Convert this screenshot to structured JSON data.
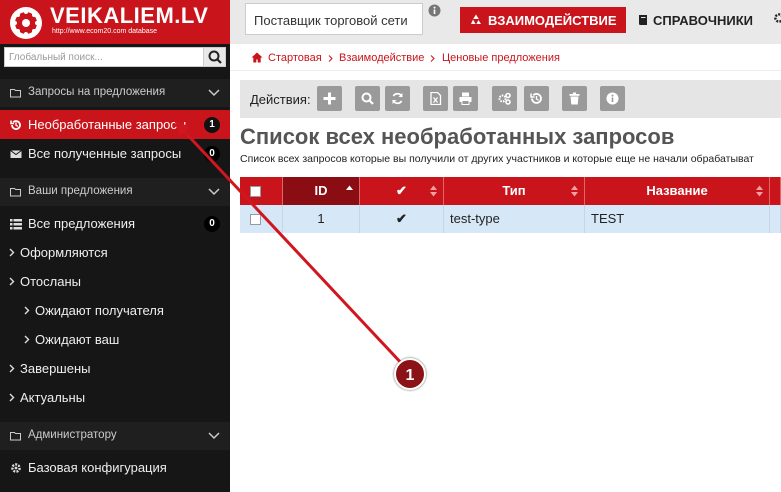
{
  "brand": {
    "name": "VEIKALIEM.LV",
    "url_text": "http://www.ecom20.com database"
  },
  "search": {
    "placeholder": "Глобальный поиск..."
  },
  "sidebar": {
    "groups": [
      {
        "label": "Запросы на предложения"
      },
      {
        "label": "Ваши предложения"
      },
      {
        "label": "Администратору"
      }
    ],
    "items": [
      {
        "label": "Необработанные запросы",
        "badge": "1"
      },
      {
        "label": "Все полученные запросы",
        "badge": "0"
      },
      {
        "label": "Все предложения",
        "badge": "0"
      },
      {
        "label": "Оформляются"
      },
      {
        "label": "Отосланы"
      },
      {
        "label": "Ожидают получателя"
      },
      {
        "label": "Ожидают ваш"
      },
      {
        "label": "Завершены"
      },
      {
        "label": "Актуальны"
      },
      {
        "label": "Базовая конфигурация"
      }
    ]
  },
  "topbar": {
    "supplier_select": "Поставщик торговой сети",
    "nav_active": "ВЗАИМОДЕЙСТВИЕ",
    "nav_reference": "СПРАВОЧНИКИ"
  },
  "breadcrumb": {
    "home": "Стартовая",
    "level1": "Взаимодействие",
    "level2": "Ценовые предложения"
  },
  "actions": {
    "label": "Действия:"
  },
  "page": {
    "title": "Список всех необработанных запросов",
    "subtitle": "Список всех запросов которые вы получили от других участников и которые еще не начали обрабатыват"
  },
  "table": {
    "columns": [
      "ID",
      "✔",
      "Тип",
      "Название"
    ],
    "rows": [
      {
        "id": "1",
        "check": "✔",
        "type": "test-type",
        "name": "TEST"
      }
    ]
  },
  "annotation": {
    "number": "1"
  },
  "colors": {
    "brand_red": "#c9141c",
    "sidebar_bg": "#161616",
    "row_selected": "#d6e8f7"
  }
}
